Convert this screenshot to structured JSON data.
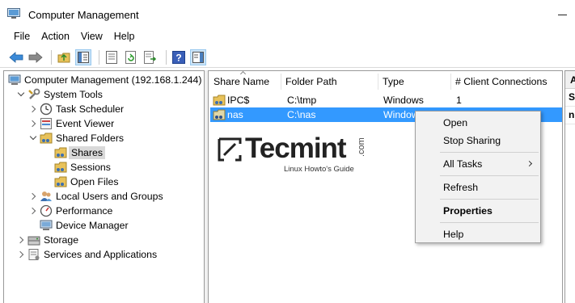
{
  "window": {
    "title": "Computer Management"
  },
  "menu": {
    "items": [
      "File",
      "Action",
      "View",
      "Help"
    ]
  },
  "toolbar": {
    "buttons": [
      "back-arrow-icon",
      "forward-arrow-icon",
      "up-folder-icon",
      "show-hide-tree-icon",
      "properties-icon",
      "refresh-icon",
      "export-list-icon",
      "help-icon",
      "show-action-pane-icon"
    ]
  },
  "tree": {
    "root": "Computer Management (192.168.1.244)",
    "system_tools": "System Tools",
    "task_scheduler": "Task Scheduler",
    "event_viewer": "Event Viewer",
    "shared_folders": "Shared Folders",
    "shares": "Shares",
    "sessions": "Sessions",
    "open_files": "Open Files",
    "local_users": "Local Users and Groups",
    "performance": "Performance",
    "device_manager": "Device Manager",
    "storage": "Storage",
    "services": "Services and Applications"
  },
  "list": {
    "columns": [
      "Share Name",
      "Folder Path",
      "Type",
      "# Client Connections"
    ],
    "rows": [
      {
        "name": "IPC$",
        "path": "C:\\tmp",
        "type": "Windows",
        "connections": "1"
      },
      {
        "name": "nas",
        "path": "C:\\nas",
        "type": "Window",
        "connections": ""
      }
    ]
  },
  "watermark": {
    "brand": "Tecmint",
    "suffix": ".com",
    "tagline": "Linux Howto's Guide"
  },
  "action_pane": {
    "header": "A",
    "row1": "S",
    "row2": "n"
  },
  "context_menu": {
    "open": "Open",
    "stop_sharing": "Stop Sharing",
    "all_tasks": "All Tasks",
    "refresh": "Refresh",
    "properties": "Properties",
    "help": "Help"
  },
  "colors": {
    "selection": "#3399ff",
    "tree_selected": "#d9d9d9",
    "menu_bg": "#f2f2f2"
  }
}
